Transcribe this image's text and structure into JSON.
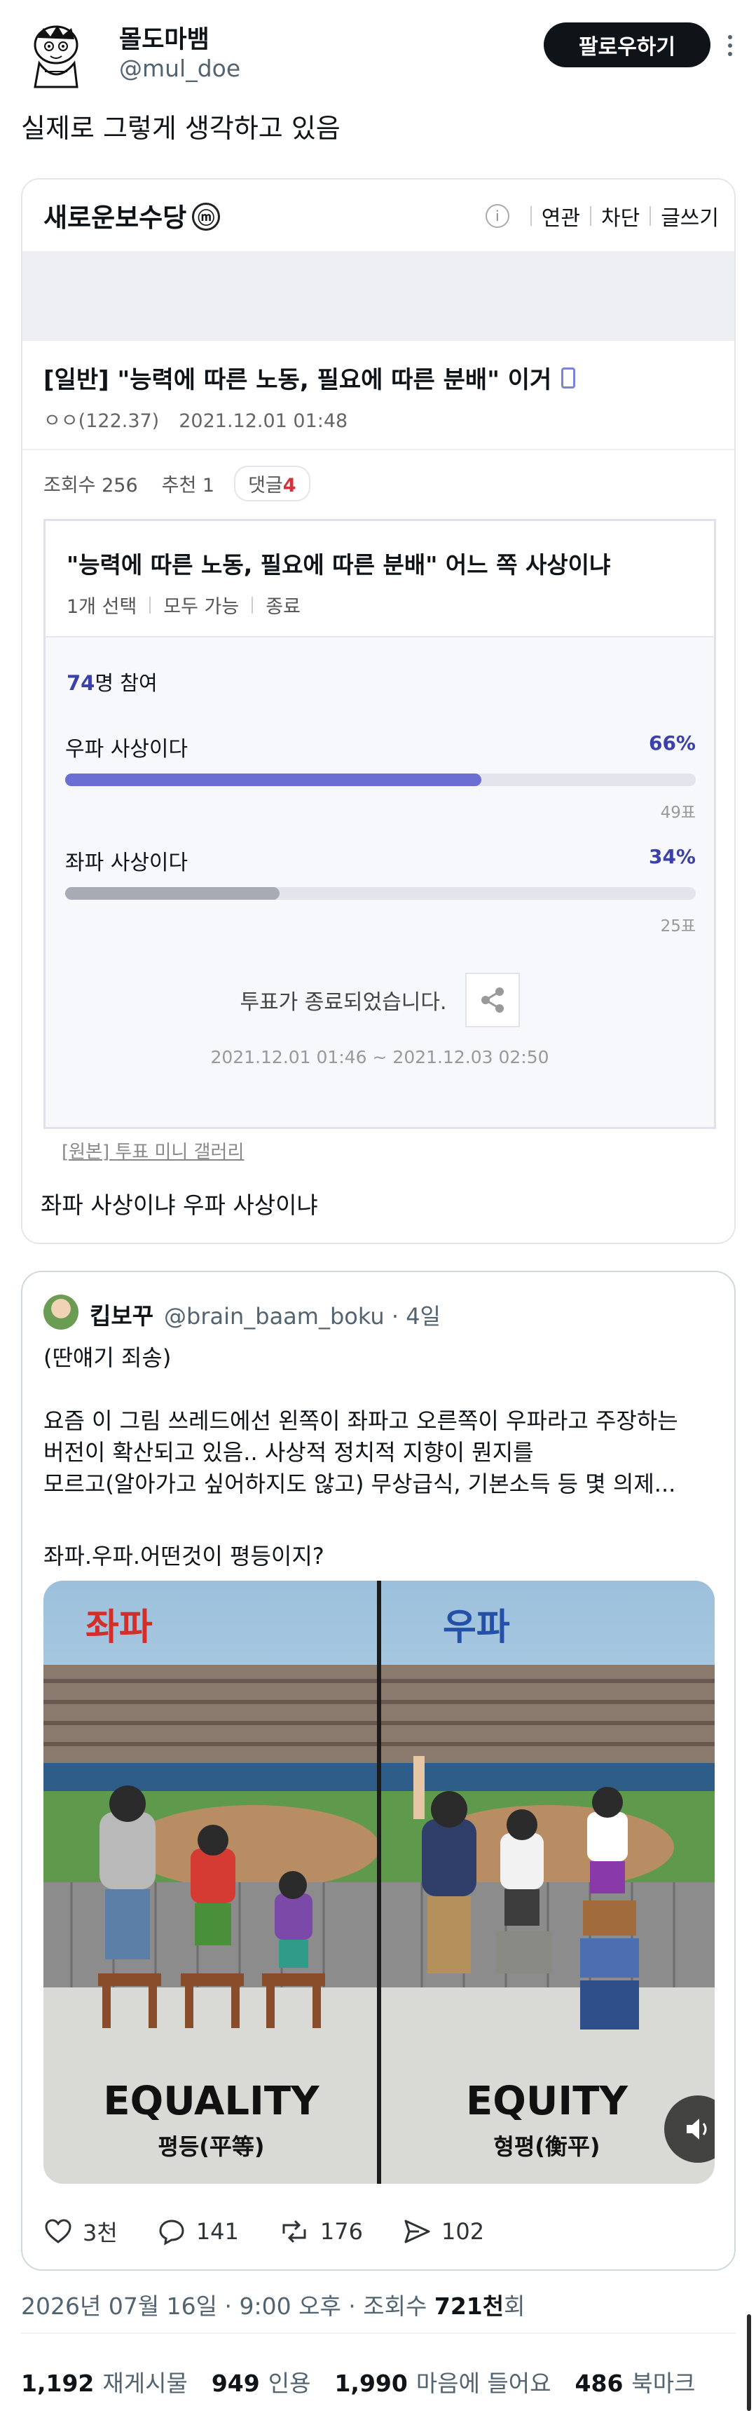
{
  "author": {
    "name": "몰도마뱀",
    "handle": "@mul_doe",
    "follow_label": "팔로우하기"
  },
  "tweet": {
    "text": "실제로 그렇게 생각하고 있음"
  },
  "post": {
    "gallery_name": "새로운보수당",
    "gallery_badge": "ⓜ",
    "nav": [
      "연관",
      "차단",
      "글쓰기"
    ],
    "title": "[일반] \"능력에 따른 노동, 필요에 따른 분배\" 이거",
    "author_ip": "ㅇㅇ(122.37)",
    "date": "2021.12.01 01:48",
    "views": "조회수 256",
    "recommend": "추천 1",
    "comments_label": "댓글",
    "comments_count": "4",
    "footer_text": "좌파 사상이냐 우파 사상이냐",
    "source_label": "[원본]",
    "source_link": "투표 미니 갤러리"
  },
  "poll": {
    "question": "\"능력에 따른 노동, 필요에 따른 분배\" 어느 쪽 사상이냐",
    "options_meta": [
      "1개 선택",
      "모두 가능",
      "종료"
    ],
    "participants": "74",
    "participants_suffix": "명 참여",
    "items": [
      {
        "label": "우파 사상이다",
        "percent": "66%",
        "fraction": 0.66,
        "votes": "49표",
        "color": "#6b6fd4"
      },
      {
        "label": "좌파 사상이다",
        "percent": "34%",
        "fraction": 0.34,
        "votes": "25표",
        "color": "#a8aab4"
      }
    ],
    "ended_text": "투표가 종료되었습니다.",
    "period": "2021.12.01 01:46 ~ 2021.12.03 02:50",
    "colors": {
      "left_pct": "#3b41a8",
      "right_pct": "#d2323c"
    }
  },
  "quoted": {
    "name": "킵보꾸",
    "handle": "@brain_baam_boku · 4일",
    "text_lines": [
      "(딴얘기 죄송)",
      "",
      "요즘 이 그림 쓰레드에선 왼쪽이 좌파고 오른쪽이 우파라고 주장하는",
      "버전이 확산되고 있음.. 사상적 정치적 지향이 뭔지를",
      "모르고(알아가고 싶어하지도 않고) 무상급식, 기본소득 등 몇 의제..."
    ],
    "image_caption": "좌파.우파.어떤것이 평등이지?",
    "image": {
      "left_title": "좌파",
      "right_title": "우파",
      "left_label": "EQUALITY",
      "left_sub": "평등(平等)",
      "right_label": "EQUITY",
      "right_sub": "형평(衡平)"
    }
  },
  "engagement": {
    "likes": "3천",
    "replies": "141",
    "retweets": "176",
    "shares": "102"
  },
  "stamp": {
    "datetime": "2026년 07월 16일 · 9:00 오후 · 조회수 ",
    "views": "721천",
    "suffix": "회"
  },
  "counts": [
    {
      "num": "1,192",
      "label": "재게시물"
    },
    {
      "num": "949",
      "label": "인용"
    },
    {
      "num": "1,990",
      "label": "마음에 들어요"
    },
    {
      "num": "486",
      "label": "북마크"
    }
  ]
}
